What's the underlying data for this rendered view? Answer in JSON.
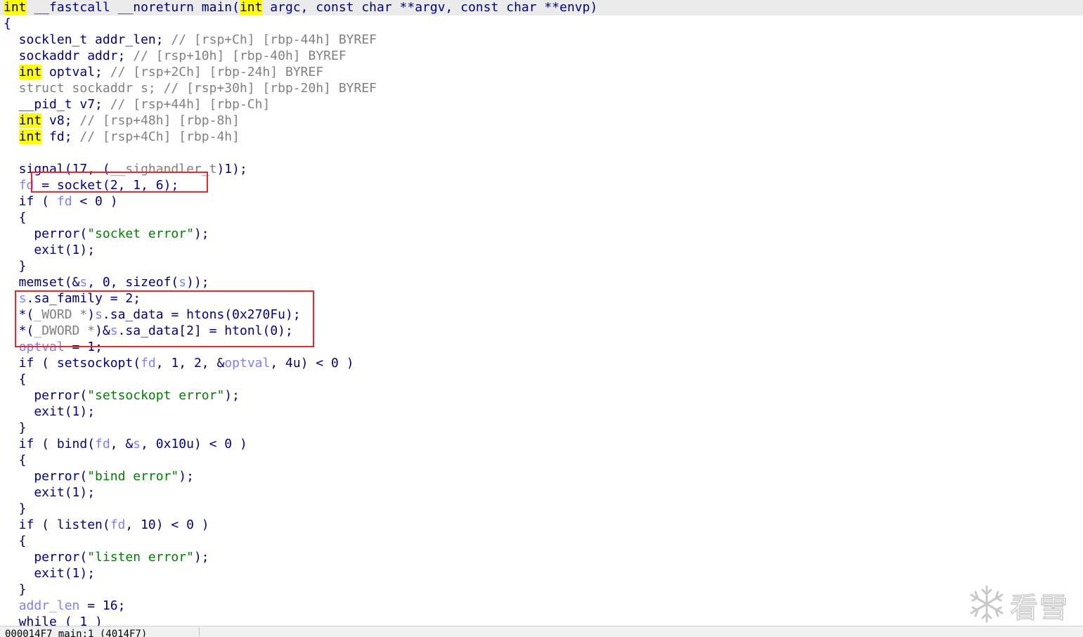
{
  "code_lines": [
    [
      [
        "kw",
        "int"
      ],
      [
        "pl",
        " __fastcall __noreturn main("
      ],
      [
        "kw",
        "int"
      ],
      [
        "pl",
        " argc, const char **argv, const char **envp)"
      ]
    ],
    [
      [
        "pl",
        "{"
      ]
    ],
    [
      [
        "pl",
        "  socklen_t addr_len; "
      ],
      [
        "cm",
        "// [rsp+Ch] [rbp-44h] BYREF"
      ]
    ],
    [
      [
        "pl",
        "  sockaddr addr; "
      ],
      [
        "cm",
        "// [rsp+10h] [rbp-40h] BYREF"
      ]
    ],
    [
      [
        "pl",
        "  "
      ],
      [
        "kw",
        "int"
      ],
      [
        "pl",
        " optval; "
      ],
      [
        "cm",
        "// [rsp+2Ch] [rbp-24h] BYREF"
      ]
    ],
    [
      [
        "cm",
        "  struct sockaddr s; // [rsp+30h] [rbp-20h] BYREF"
      ]
    ],
    [
      [
        "pl",
        "  __pid_t v7; "
      ],
      [
        "cm",
        "// [rsp+44h] [rbp-Ch]"
      ]
    ],
    [
      [
        "pl",
        "  "
      ],
      [
        "kw",
        "int"
      ],
      [
        "pl",
        " v8; "
      ],
      [
        "cm",
        "// [rsp+48h] [rbp-8h]"
      ]
    ],
    [
      [
        "pl",
        "  "
      ],
      [
        "kw",
        "int"
      ],
      [
        "pl",
        " fd; "
      ],
      [
        "cm",
        "// [rsp+4Ch] [rbp-4h]"
      ]
    ],
    [],
    [
      [
        "pl",
        "  signal(17, ("
      ],
      [
        "cm",
        "__sighandler_t"
      ],
      [
        "pl",
        ")1);"
      ]
    ],
    [
      [
        "pl",
        "  "
      ],
      [
        "var",
        "fd"
      ],
      [
        "pl",
        " = socket(2, 1, 6);"
      ]
    ],
    [
      [
        "pl",
        "  if ( "
      ],
      [
        "var",
        "fd"
      ],
      [
        "pl",
        " < 0 )"
      ]
    ],
    [
      [
        "pl",
        "  {"
      ]
    ],
    [
      [
        "pl",
        "    perror("
      ],
      [
        "str",
        "\"socket error\""
      ],
      [
        "pl",
        ");"
      ]
    ],
    [
      [
        "pl",
        "    exit(1);"
      ]
    ],
    [
      [
        "pl",
        "  }"
      ]
    ],
    [
      [
        "pl",
        "  memset(&"
      ],
      [
        "var",
        "s"
      ],
      [
        "pl",
        ", 0, sizeof("
      ],
      [
        "var",
        "s"
      ],
      [
        "pl",
        "));"
      ]
    ],
    [
      [
        "pl",
        "  "
      ],
      [
        "var",
        "s"
      ],
      [
        "pl",
        ".sa_family = 2;"
      ]
    ],
    [
      [
        "pl",
        "  *("
      ],
      [
        "cm",
        "_WORD *"
      ],
      [
        "pl",
        ")"
      ],
      [
        "var",
        "s"
      ],
      [
        "pl",
        ".sa_data = htons(0x270Fu);"
      ]
    ],
    [
      [
        "pl",
        "  *("
      ],
      [
        "cm",
        "_DWORD *"
      ],
      [
        "pl",
        ")&"
      ],
      [
        "var",
        "s"
      ],
      [
        "pl",
        ".sa_data[2] = htonl(0);"
      ]
    ],
    [
      [
        "pl",
        "  "
      ],
      [
        "var",
        "optval"
      ],
      [
        "pl",
        " = 1;"
      ]
    ],
    [
      [
        "pl",
        "  if ( setsockopt("
      ],
      [
        "var",
        "fd"
      ],
      [
        "pl",
        ", 1, 2, &"
      ],
      [
        "var",
        "optval"
      ],
      [
        "pl",
        ", 4u) < 0 )"
      ]
    ],
    [
      [
        "pl",
        "  {"
      ]
    ],
    [
      [
        "pl",
        "    perror("
      ],
      [
        "str",
        "\"setsockopt error\""
      ],
      [
        "pl",
        ");"
      ]
    ],
    [
      [
        "pl",
        "    exit(1);"
      ]
    ],
    [
      [
        "pl",
        "  }"
      ]
    ],
    [
      [
        "pl",
        "  if ( bind("
      ],
      [
        "var",
        "fd"
      ],
      [
        "pl",
        ", &"
      ],
      [
        "var",
        "s"
      ],
      [
        "pl",
        ", 0x10u) < 0 )"
      ]
    ],
    [
      [
        "pl",
        "  {"
      ]
    ],
    [
      [
        "pl",
        "    perror("
      ],
      [
        "str",
        "\"bind error\""
      ],
      [
        "pl",
        ");"
      ]
    ],
    [
      [
        "pl",
        "    exit(1);"
      ]
    ],
    [
      [
        "pl",
        "  }"
      ]
    ],
    [
      [
        "pl",
        "  if ( listen("
      ],
      [
        "var",
        "fd"
      ],
      [
        "pl",
        ", 10) < 0 )"
      ]
    ],
    [
      [
        "pl",
        "  {"
      ]
    ],
    [
      [
        "pl",
        "    perror("
      ],
      [
        "str",
        "\"listen error\""
      ],
      [
        "pl",
        ");"
      ]
    ],
    [
      [
        "pl",
        "    exit(1);"
      ]
    ],
    [
      [
        "pl",
        "  }"
      ]
    ],
    [
      [
        "pl",
        "  "
      ],
      [
        "var",
        "addr_len"
      ],
      [
        "pl",
        " = 16;"
      ]
    ],
    [
      [
        "pl",
        "  while ( 1 )"
      ]
    ]
  ],
  "status_bar": {
    "text": "000014F7 main:1 (4014F7)"
  },
  "watermark": {
    "text": "看雪"
  },
  "colors": {
    "keyword_bg": "#ffff00",
    "plain": "#000080",
    "comment": "#808080",
    "variable": "#7f7fff",
    "string": "#008000",
    "highlight_box": "#e8262e"
  }
}
